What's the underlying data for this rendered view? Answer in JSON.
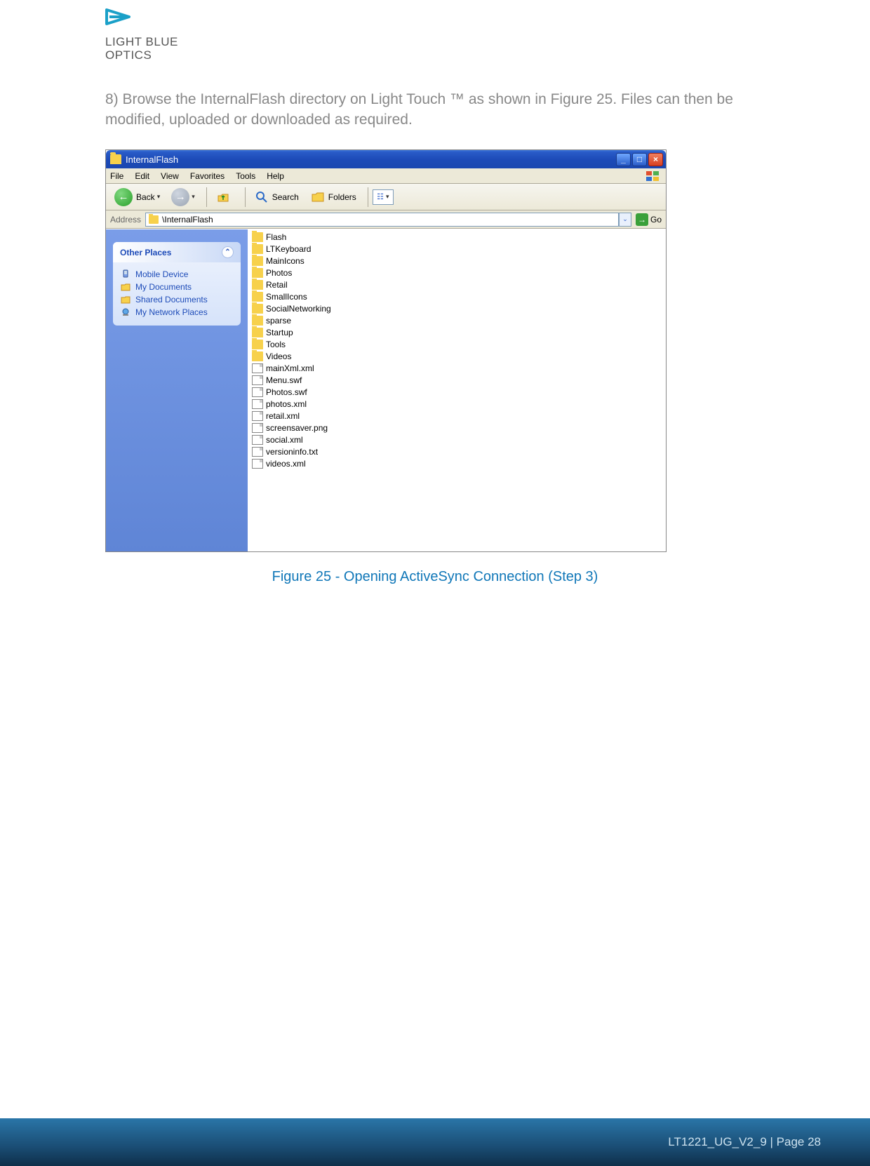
{
  "logo": {
    "line1": "LIGHT BLUE",
    "line2": "OPTICS"
  },
  "body_paragraph": "8) Browse the InternalFlash directory on Light Touch ™ as shown in Figure 25. Files can then be modified, uploaded or downloaded as required.",
  "caption": "Figure 25 - Opening ActiveSync Connection (Step 3)",
  "footer": "LT1221_UG_V2_9 | Page 28",
  "explorer": {
    "title": "InternalFlash",
    "menu": [
      "File",
      "Edit",
      "View",
      "Favorites",
      "Tools",
      "Help"
    ],
    "toolbar": {
      "back": "Back",
      "search": "Search",
      "folders": "Folders"
    },
    "address_label": "Address",
    "address_path": "\\InternalFlash",
    "go_label": "Go",
    "task_header": "Other Places",
    "task_items": [
      "Mobile Device",
      "My Documents",
      "Shared Documents",
      "My Network Places"
    ],
    "folders": [
      "Flash",
      "LTKeyboard",
      "MainIcons",
      "Photos",
      "Retail",
      "SmallIcons",
      "SocialNetworking",
      "sparse",
      "Startup",
      "Tools",
      "Videos"
    ],
    "docs": [
      "mainXml.xml",
      "Menu.swf",
      "Photos.swf",
      "photos.xml",
      "retail.xml",
      "screensaver.png",
      "social.xml",
      "versioninfo.txt",
      "videos.xml"
    ]
  }
}
